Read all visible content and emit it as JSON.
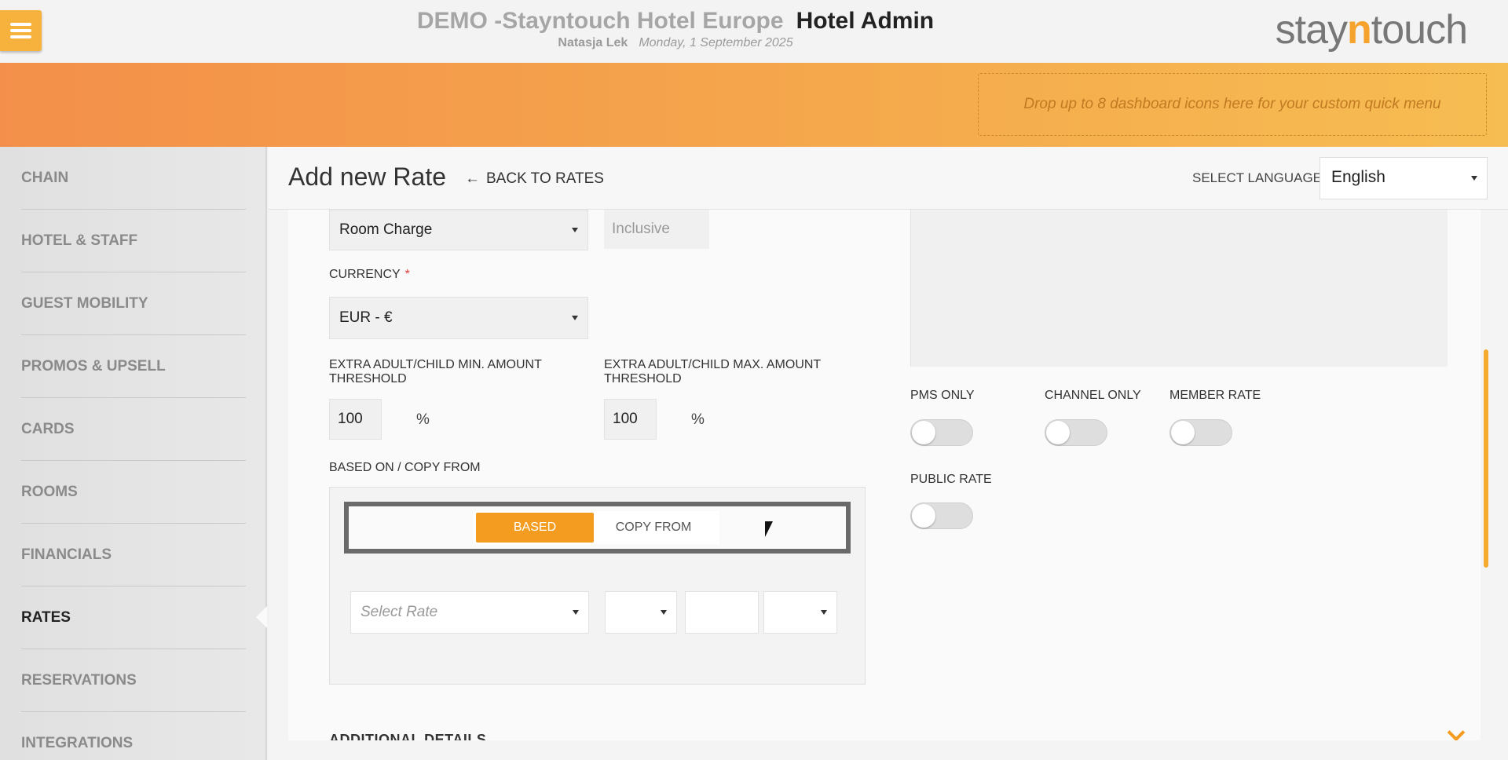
{
  "header": {
    "hotel_name": "DEMO -Stayntouch Hotel Europe",
    "app_name": "Hotel Admin",
    "user": "Natasja Lek",
    "date": "Monday, 1 September 2025",
    "logo_pre": "stay",
    "logo_n": "n",
    "logo_post": "touch"
  },
  "banner": {
    "dropzone_text": "Drop up to 8 dashboard icons here for your custom quick menu"
  },
  "sidebar": {
    "items": [
      {
        "label": "CHAIN"
      },
      {
        "label": "HOTEL & STAFF"
      },
      {
        "label": "GUEST MOBILITY"
      },
      {
        "label": "PROMOS & UPSELL"
      },
      {
        "label": "CARDS"
      },
      {
        "label": "ROOMS"
      },
      {
        "label": "FINANCIALS"
      },
      {
        "label": "RATES"
      },
      {
        "label": "RESERVATIONS"
      },
      {
        "label": "INTEGRATIONS"
      }
    ],
    "active": "RATES"
  },
  "page": {
    "title": "Add new Rate",
    "back_label": "BACK TO RATES",
    "back_arrow": "←",
    "language_label": "SELECT LANGUAGE",
    "language_value": "English"
  },
  "form": {
    "charge_type": "Room Charge",
    "inclusive_placeholder": "Inclusive",
    "currency_label": "CURRENCY",
    "currency_required": "*",
    "currency_value": "EUR - €",
    "min_threshold_label": "EXTRA ADULT/CHILD MIN. AMOUNT THRESHOLD",
    "min_threshold_value": "100",
    "max_threshold_label": "EXTRA ADULT/CHILD MAX. AMOUNT THRESHOLD",
    "max_threshold_value": "100",
    "percent_symbol": "%",
    "based_on_label": "BASED ON / COPY FROM",
    "tab_based": "BASED",
    "tab_copy_from": "COPY FROM",
    "select_rate_placeholder": "Select Rate",
    "pms_only_label": "PMS ONLY",
    "channel_only_label": "CHANNEL ONLY",
    "member_rate_label": "MEMBER RATE",
    "public_rate_label": "PUBLIC RATE",
    "additional_details_label": "ADDITIONAL DETAILS"
  },
  "colors": {
    "accent": "#f39c1f",
    "banner_start": "#f38f4a",
    "banner_end": "#f6bd52"
  }
}
